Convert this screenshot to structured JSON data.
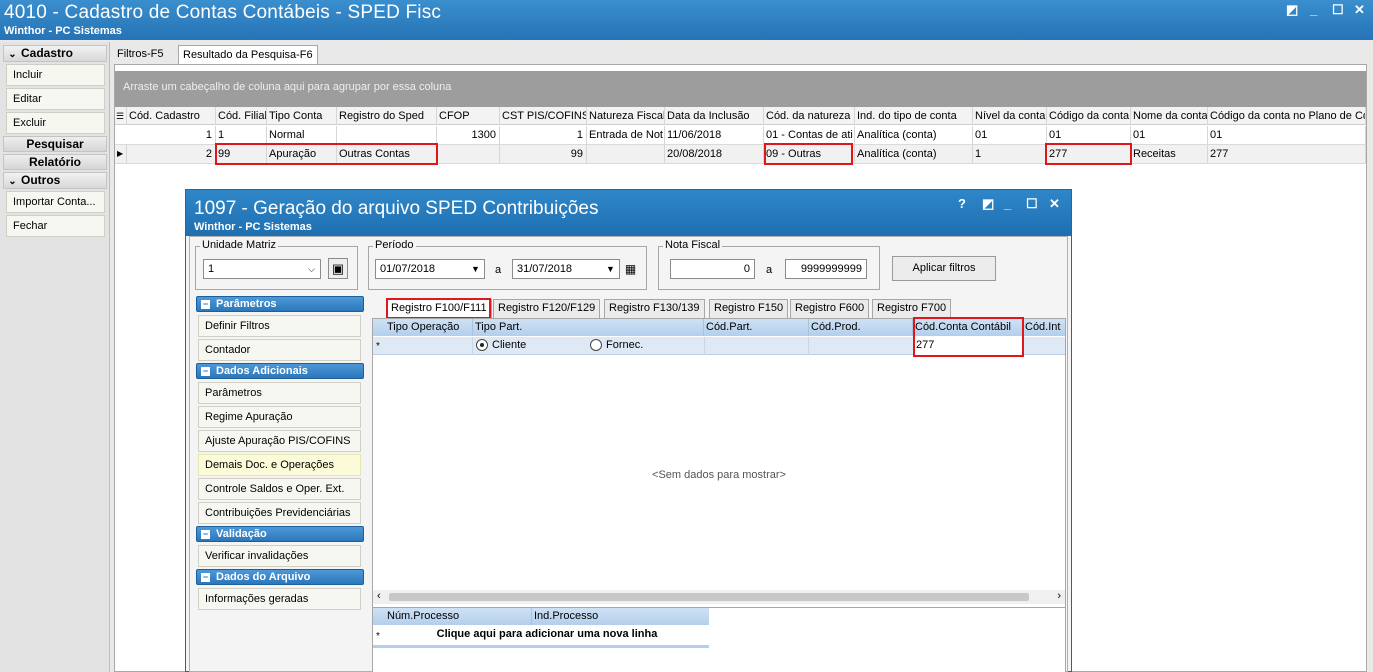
{
  "outer": {
    "title": "4010 - Cadastro de Contas Contábeis - SPED Fisc",
    "subtitle": "Winthor - PC Sistemas",
    "controls": [
      "◩",
      "_",
      "☐",
      "✕"
    ]
  },
  "left_menu": {
    "group_cadastro": "Cadastro",
    "btn_incluir": "Incluir",
    "btn_editar": "Editar",
    "btn_excluir": "Excluir",
    "group_pesquisar": "Pesquisar",
    "group_relatorio": "Relatório",
    "group_outros": "Outros",
    "btn_importar": "Importar Conta...",
    "btn_fechar": "Fechar"
  },
  "outer_tabs": [
    "Filtros-F5",
    "Resultado da Pesquisa-F6"
  ],
  "group_hint": "Arraste um cabeçalho de coluna aqui para agrupar por essa coluna",
  "grid": {
    "headers": [
      "Cód. Cadastro",
      "Cód. Filial",
      "Tipo Conta",
      "Registro do Sped",
      "CFOP",
      "CST PIS/COFINS",
      "Natureza Fiscal",
      "Data da Inclusão",
      "Cód. da natureza",
      "Ind. do tipo de conta",
      "Nível da conta",
      "Código da conta",
      "Nome da conta",
      "Código da conta no Plano de Co"
    ],
    "rows": [
      [
        "1",
        "1",
        "Normal",
        "",
        "1300",
        "1",
        "Entrada de Not",
        "11/06/2018",
        "01 - Contas de ati",
        "Analítica (conta)",
        "01",
        "01",
        "01",
        "01"
      ],
      [
        "2",
        "99",
        "Apuração",
        "Outras Contas",
        "",
        "99",
        "",
        "20/08/2018",
        "09 - Outras",
        "Analítica (conta)",
        "1",
        "277",
        "Receitas",
        "277"
      ]
    ]
  },
  "inner": {
    "title": "1097 - Geração do arquivo SPED Contribuições",
    "subtitle": "Winthor - PC Sistemas",
    "controls": [
      "?",
      "◩",
      "_",
      "☐",
      "✕"
    ],
    "unidade_label": "Unidade Matriz",
    "unidade_value": "1",
    "periodo_label": "Período",
    "periodo_inicio": "01/07/2018",
    "periodo_a": "a",
    "periodo_fim": "31/07/2018",
    "nf_label": "Nota Fiscal",
    "nf_inicio": "0",
    "nf_a": "a",
    "nf_fim": "9999999999",
    "aplicar": "Aplicar filtros",
    "side": {
      "grp_parametros": "Parâmetros",
      "definir_filtros": "Definir Filtros",
      "contador": "Contador",
      "grp_dados_adicionais": "Dados Adicionais",
      "parametros": "Parâmetros",
      "regime": "Regime Apuração",
      "ajuste": "Ajuste Apuração PIS/COFINS",
      "demais": "Demais Doc. e Operações",
      "controle": "Controle Saldos e Oper. Ext.",
      "contribuicoes": "Contribuições Previdenciárias",
      "grp_validacao": "Validação",
      "verificar": "Verificar invalidações",
      "grp_dados_arquivo": "Dados do Arquivo",
      "informacoes": "Informações geradas"
    },
    "tabs": [
      "Registro F100/F111",
      "Registro F120/F129",
      "Registro F130/139",
      "Registro F150",
      "Registro F600",
      "Registro F700"
    ],
    "grid_headers": [
      "Tipo Operação",
      "Tipo Part.",
      "Cód.Part.",
      "Cód.Prod.",
      "Cód.Conta Contábil",
      "Cód.Int"
    ],
    "row_marker": "*",
    "radio_cliente": "Cliente",
    "radio_fornec": "Fornec.",
    "conta_value": "277",
    "empty_msg": "<Sem dados para mostrar>",
    "bottom_headers": [
      "Núm.Processo",
      "Ind.Processo"
    ],
    "add_row": "Clique aqui para adicionar uma nova linha"
  }
}
